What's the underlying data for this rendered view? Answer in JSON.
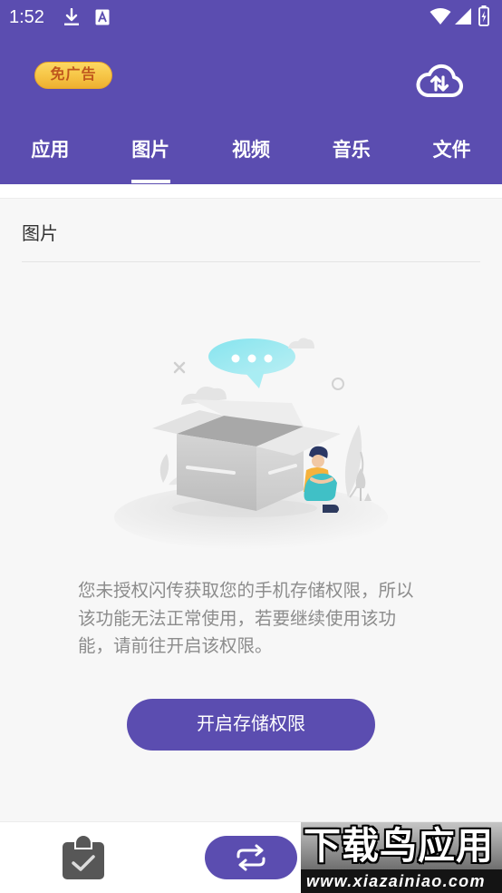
{
  "status_bar": {
    "time": "1:52",
    "left_icons": [
      "download-icon",
      "font-a-icon"
    ],
    "right_icons": [
      "wifi-icon",
      "signal-icon",
      "battery-charging-icon"
    ]
  },
  "header": {
    "badge_label": "免广告",
    "right_icon": "cloud-sync-icon"
  },
  "tabs": [
    {
      "label": "应用",
      "active": false
    },
    {
      "label": "图片",
      "active": true
    },
    {
      "label": "视频",
      "active": false
    },
    {
      "label": "音乐",
      "active": false
    },
    {
      "label": "文件",
      "active": false
    }
  ],
  "section": {
    "title": "图片"
  },
  "empty_state": {
    "illustration": "open-box-person-illustration",
    "message_lines": [
      "您未授权闪传获取您的手机存储权限，所以",
      "该功能无法正常使用，若要继续使用该功",
      "能，请前往开启该权限。"
    ],
    "button_label": "开启存储权限"
  },
  "bottom_bar": {
    "left_icon": "clipboard-check-icon",
    "center_icon": "swap-arrows-icon"
  },
  "watermark": {
    "title": "下载鸟应用",
    "url": "www.xiazainiao.com"
  },
  "colors": {
    "primary": "#5b4db0",
    "badge": "#f6c445",
    "badge_text": "#bf561d",
    "message_text": "#8c8c8c",
    "background": "#f7f7f7",
    "title_text": "#333333"
  }
}
